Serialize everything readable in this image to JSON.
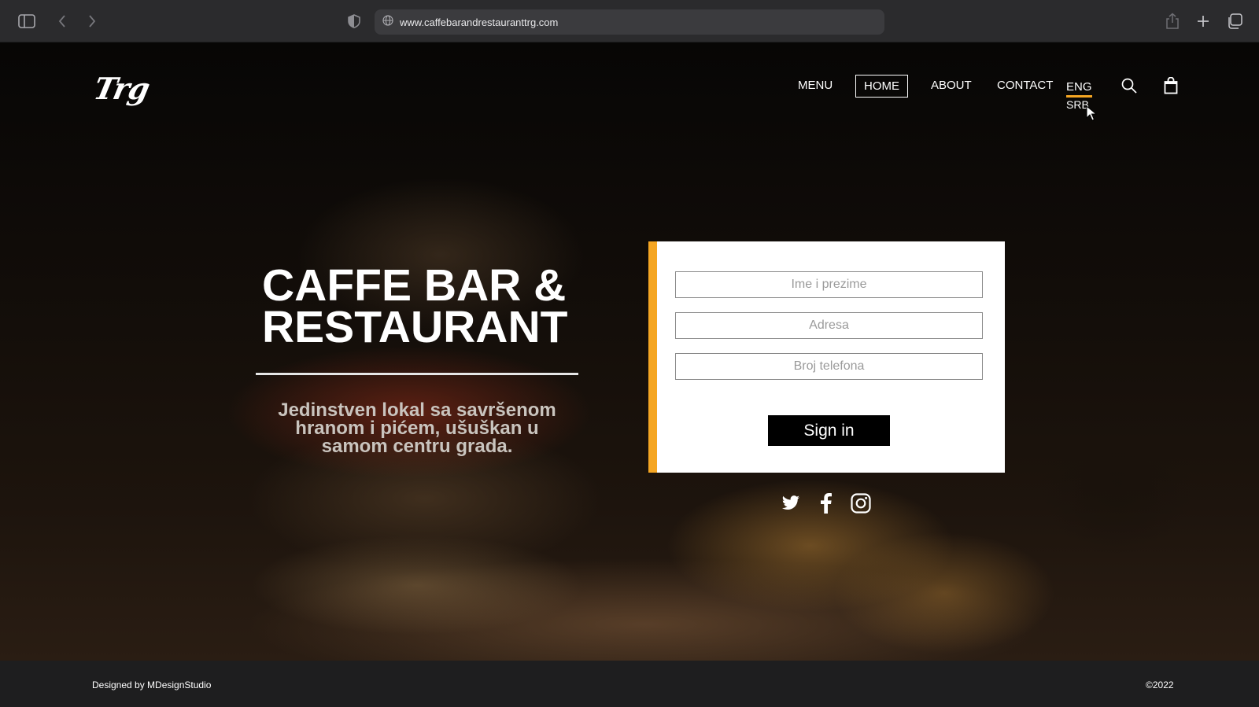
{
  "browser": {
    "url": "www.caffebarandrestauranttrg.com",
    "icons": [
      "sidebar-toggle-icon",
      "back-icon",
      "forward-icon",
      "shield-icon",
      "globe-icon",
      "share-icon",
      "new-tab-icon",
      "tabs-overview-icon"
    ]
  },
  "header": {
    "logo_text": "Trg",
    "nav": {
      "menu": "MENU",
      "home": "HOME",
      "about": "ABOUT",
      "contact": "CONTACT"
    },
    "language": {
      "active": "ENG",
      "alternate": "SRB"
    },
    "icons": [
      "search-icon",
      "shopping-bag-icon"
    ]
  },
  "hero": {
    "title": "CAFFE BAR & RESTAURANT",
    "subtitle": "Jedinstven lokal sa savršenom hranom i pićem, ušuškan u samom centru grada."
  },
  "form": {
    "name_placeholder": "Ime i prezime",
    "address_placeholder": "Adresa",
    "phone_placeholder": "Broj telefona",
    "submit_label": "Sign in"
  },
  "social": [
    "twitter-icon",
    "facebook-icon",
    "instagram-icon"
  ],
  "footer": {
    "credit": "Designed by MDesignStudio",
    "copyright": "©2022"
  },
  "colors": {
    "accent": "#f5a623",
    "chrome_bg": "#2b2b2d",
    "footer_bg": "#1e1e1f"
  }
}
